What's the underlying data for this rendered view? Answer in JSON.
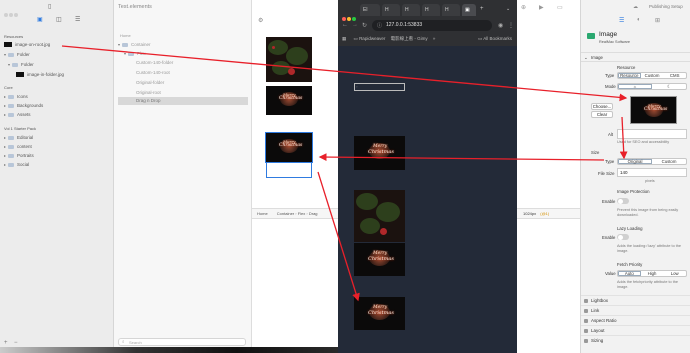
{
  "left": {
    "section_resources": "Resources",
    "resources": [
      {
        "label": "image-on-root.jpg",
        "kind": "image"
      },
      {
        "label": "Folder",
        "kind": "folder"
      },
      {
        "label": "Folder",
        "kind": "folder"
      },
      {
        "label": "image-in-folder.jpg",
        "kind": "image"
      }
    ],
    "section_core": "Core",
    "core_items": [
      "Icons",
      "Backgrounds",
      "Assets"
    ],
    "section_pack": "Vol 1 Starter Pack",
    "pack_items": [
      "Editorial",
      "content",
      "Portraits",
      "Social"
    ]
  },
  "middle": {
    "title": "Test.elements",
    "header": "Home",
    "nodes": [
      "Container",
      "Flex",
      "Custom-140-folder",
      "Custom-140-root",
      "Original-folder",
      "Original-root",
      "Drag n Drop"
    ],
    "selected_index": 6,
    "search_placeholder": "Search"
  },
  "bottom_bar": {
    "crumbs": [
      "Home",
      "Container",
      "Flex",
      "Drag"
    ],
    "size": "1024px",
    "badge": "(@1)"
  },
  "browser": {
    "tab_labels": [
      "El",
      "H",
      "H",
      "H",
      "H"
    ],
    "url": "127.0.0.1:53833",
    "bookmarks": [
      "Rapidweaver",
      "電影線上看 - Gimy"
    ],
    "all_bookmarks": "All Bookmarks"
  },
  "card_text": {
    "line1": "Merry",
    "line2": "Christmas"
  },
  "right": {
    "toolbar_title": "Publishing Setup",
    "component_name": "Image",
    "component_vendor": "RealMac Software",
    "section_image": "Image",
    "resource_heading": "Resource",
    "type_label": "Type",
    "type_options": [
      "Resource",
      "Custom",
      "CMS"
    ],
    "type_selected": 0,
    "mode_label": "Mode",
    "choose_button": "Choose...",
    "clear_button": "Clear",
    "alt_label": "Alt",
    "alt_hint": "Used for SEO and accessibility",
    "size_label": "Size",
    "size_type_label": "Type",
    "size_options": [
      "Original",
      "Custom"
    ],
    "size_selected": 0,
    "file_size_label": "File Size",
    "file_size_value": "140",
    "file_size_unit": "pixels",
    "protection_heading": "Image Protection",
    "protection_enable": "Enable",
    "protection_desc": "Prevent this image from being easily downloaded.",
    "lazy_heading": "Lazy Loading",
    "lazy_enable": "Enable",
    "lazy_desc": "Adds the loading='lazy' attribute to the image.",
    "fetch_heading": "Fetch Priority",
    "fetch_value_label": "Value",
    "fetch_options": [
      "Auto",
      "High",
      "Low"
    ],
    "fetch_selected": 0,
    "fetch_desc": "Adds the fetchpriority attribute to the image.",
    "accordions": [
      "Lightbox",
      "Link",
      "Aspect Ratio",
      "Layout",
      "Sizing"
    ]
  },
  "colors": {
    "annotation_arrow": "#e8202a",
    "accent": "#2f7be0"
  }
}
